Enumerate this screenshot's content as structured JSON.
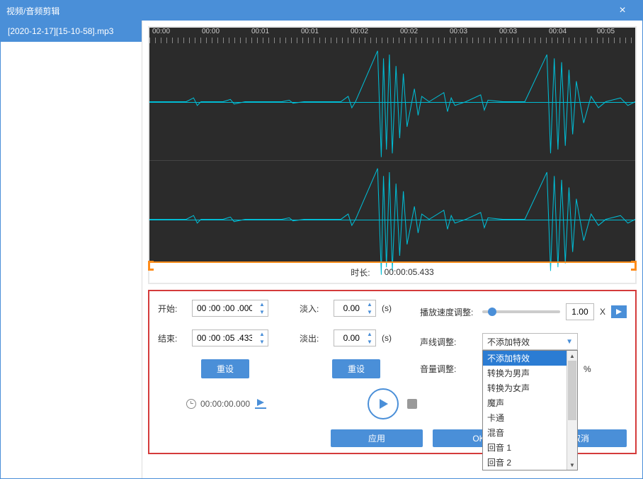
{
  "title": "视频/音频剪辑",
  "sidebar": {
    "items": [
      {
        "label": "[2020-12-17][15-10-58].mp3"
      }
    ]
  },
  "timeline": {
    "ticks": [
      "00:00",
      "00:00",
      "00:01",
      "00:01",
      "00:02",
      "00:02",
      "00:03",
      "00:03",
      "00:04",
      "00:05"
    ]
  },
  "duration": {
    "label": "时长:",
    "value": "00:00:05.433"
  },
  "controls": {
    "start_label": "开始:",
    "start_value": "00 :00 :00 .000",
    "end_label": "结束:",
    "end_value": "00 :00 :05 .433",
    "reset_label": "重设",
    "fadein_label": "淡入:",
    "fadein_value": "0.00",
    "sec_unit": "(s)",
    "fadeout_label": "淡出:",
    "fadeout_value": "0.00",
    "speed_label": "播放速度调整:",
    "speed_value": "1.00",
    "speed_unit": "X",
    "voice_label": "声线调整:",
    "voice_selected": "不添加特效",
    "voice_options": [
      "不添加特效",
      "转换为男声",
      "转换为女声",
      "魔声",
      "卡通",
      "混音",
      "回音 1",
      "回音 2"
    ],
    "volume_label": "音量调整:",
    "volume_unit": "%"
  },
  "playback": {
    "time": "00:00:00.000"
  },
  "buttons": {
    "apply": "应用",
    "ok": "OK",
    "cancel": "取消"
  }
}
